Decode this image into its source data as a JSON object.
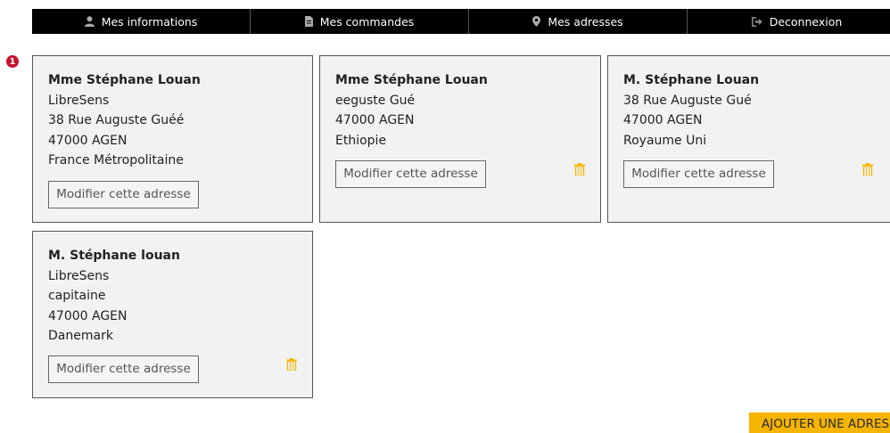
{
  "nav": {
    "items": [
      {
        "label": "Mes informations",
        "icon": "user-icon"
      },
      {
        "label": "Mes commandes",
        "icon": "document-icon"
      },
      {
        "label": "Mes adresses",
        "icon": "map-marker-icon"
      },
      {
        "label": "Deconnexion",
        "icon": "sign-out-icon"
      }
    ]
  },
  "notice": {
    "count": "1",
    "color": "#c8102e"
  },
  "addresses": [
    {
      "name": "Mme Stéphane Louan",
      "lines": [
        "LibreSens",
        "38 Rue Auguste Guéé",
        "47000 AGEN",
        "France Métropolitaine"
      ],
      "modify_label": "Modifier cette adresse",
      "deletable": false
    },
    {
      "name": "Mme Stéphane Louan",
      "lines": [
        "eeguste Gué",
        "47000 AGEN",
        "Ethiopie"
      ],
      "modify_label": "Modifier cette adresse",
      "deletable": true
    },
    {
      "name": "M. Stéphane Louan",
      "lines": [
        "38 Rue Auguste Gué",
        "47000 AGEN",
        "Royaume Uni"
      ],
      "modify_label": "Modifier cette adresse",
      "deletable": true
    },
    {
      "name": "M. Stéphane louan",
      "lines": [
        "LibreSens",
        "capitaine",
        "47000 AGEN",
        "Danemark"
      ],
      "modify_label": "Modifier cette adresse",
      "deletable": true
    }
  ],
  "add_button_label": "AJOUTER UNE ADRESSE",
  "colors": {
    "accent": "#f5b400",
    "trash": "#f5b400",
    "nav_bg": "#000000"
  }
}
